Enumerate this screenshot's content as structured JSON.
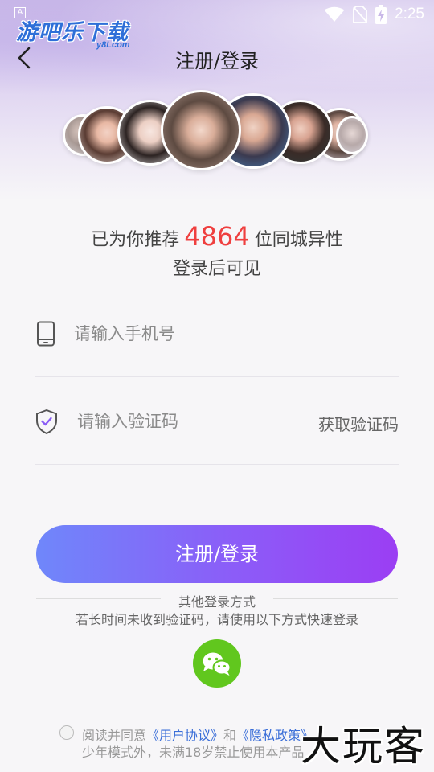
{
  "status_bar": {
    "time": "2:25",
    "notification_glyph": "A",
    "icons": [
      "wifi-icon",
      "no-sim-icon",
      "battery-charging-icon"
    ]
  },
  "watermark": {
    "top_logo": "游吧乐下载",
    "top_logo_sub": "y8Lcom",
    "bottom_logo": "大玩客"
  },
  "header": {
    "title": "注册/登录",
    "back_icon": "chevron-left-icon"
  },
  "avatars": {
    "count": 8
  },
  "recommendation": {
    "prefix": "已为你推荐",
    "count": "4864",
    "suffix": "位同城异性",
    "subtitle": "登录后可见"
  },
  "phone_field": {
    "icon": "phone-icon",
    "placeholder": "请输入手机号",
    "value": ""
  },
  "code_field": {
    "icon": "shield-check-icon",
    "placeholder": "请输入验证码",
    "value": "",
    "get_code_label": "获取验证码"
  },
  "submit_button": {
    "label": "注册/登录"
  },
  "other_login": {
    "title": "其他登录方式",
    "hint": "若长时间未收到验证码，请使用以下方式快速登录",
    "wechat_icon": "wechat-icon"
  },
  "agreement": {
    "checked": false,
    "text_prefix": "阅读并同意",
    "user_agreement": "《用户协议》",
    "and": "和",
    "privacy_policy": "《隐私政策》",
    "line2": "少年模式外，未满18岁禁止使用本产品"
  },
  "colors": {
    "accent_start": "#6f87fa",
    "accent_end": "#9b3ef3",
    "highlight_red": "#ef3f3f",
    "link_blue": "#3a6ed8",
    "wechat_green": "#61c71e"
  }
}
